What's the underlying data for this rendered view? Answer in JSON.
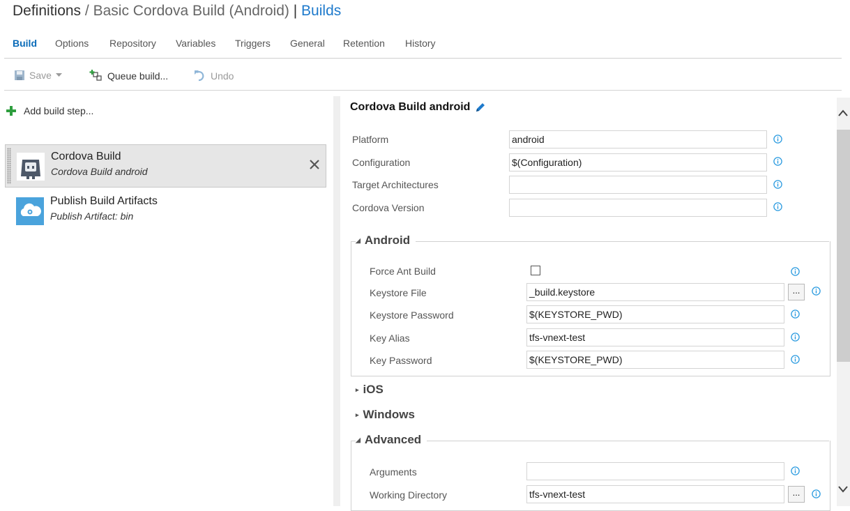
{
  "header": {
    "crumb_root": "Definitions",
    "separator": "/",
    "definition_name": "Basic Cordova Build (Android)",
    "pipe": "|",
    "builds_link": "Builds"
  },
  "tabs": [
    "Build",
    "Options",
    "Repository",
    "Variables",
    "Triggers",
    "General",
    "Retention",
    "History"
  ],
  "active_tab": "Build",
  "toolbar": {
    "save_label": "Save",
    "queue_label": "Queue build...",
    "undo_label": "Undo"
  },
  "steps_pane": {
    "add_label": "Add build step...",
    "steps": [
      {
        "name": "Cordova Build",
        "sub": "Cordova Build android",
        "selected": true
      },
      {
        "name": "Publish Build Artifacts",
        "sub": "Publish Artifact: bin",
        "selected": false
      }
    ]
  },
  "details": {
    "title": "Cordova Build android",
    "fields": [
      {
        "label": "Platform",
        "value": "android"
      },
      {
        "label": "Configuration",
        "value": "$(Configuration)"
      },
      {
        "label": "Target Architectures",
        "value": ""
      },
      {
        "label": "Cordova Version",
        "value": ""
      }
    ],
    "android": {
      "title": "Android",
      "force_ant_label": "Force Ant Build",
      "force_ant_checked": false,
      "fields": [
        {
          "label": "Keystore File",
          "value": "_build.keystore"
        },
        {
          "label": "Keystore Password",
          "value": "$(KEYSTORE_PWD)"
        },
        {
          "label": "Key Alias",
          "value": "tfs-vnext-test"
        },
        {
          "label": "Key Password",
          "value": "$(KEYSTORE_PWD)"
        }
      ],
      "browse_label": "..."
    },
    "ios_title": "iOS",
    "windows_title": "Windows",
    "advanced": {
      "title": "Advanced",
      "fields": [
        {
          "label": "Arguments",
          "value": ""
        },
        {
          "label": "Working Directory",
          "value": "tfs-vnext-test"
        }
      ],
      "browse_label": "..."
    }
  },
  "colors": {
    "accent": "#0a6bb8",
    "link": "#1e7acc",
    "info": "#2b9be0",
    "add_green": "#2e9e3e"
  }
}
